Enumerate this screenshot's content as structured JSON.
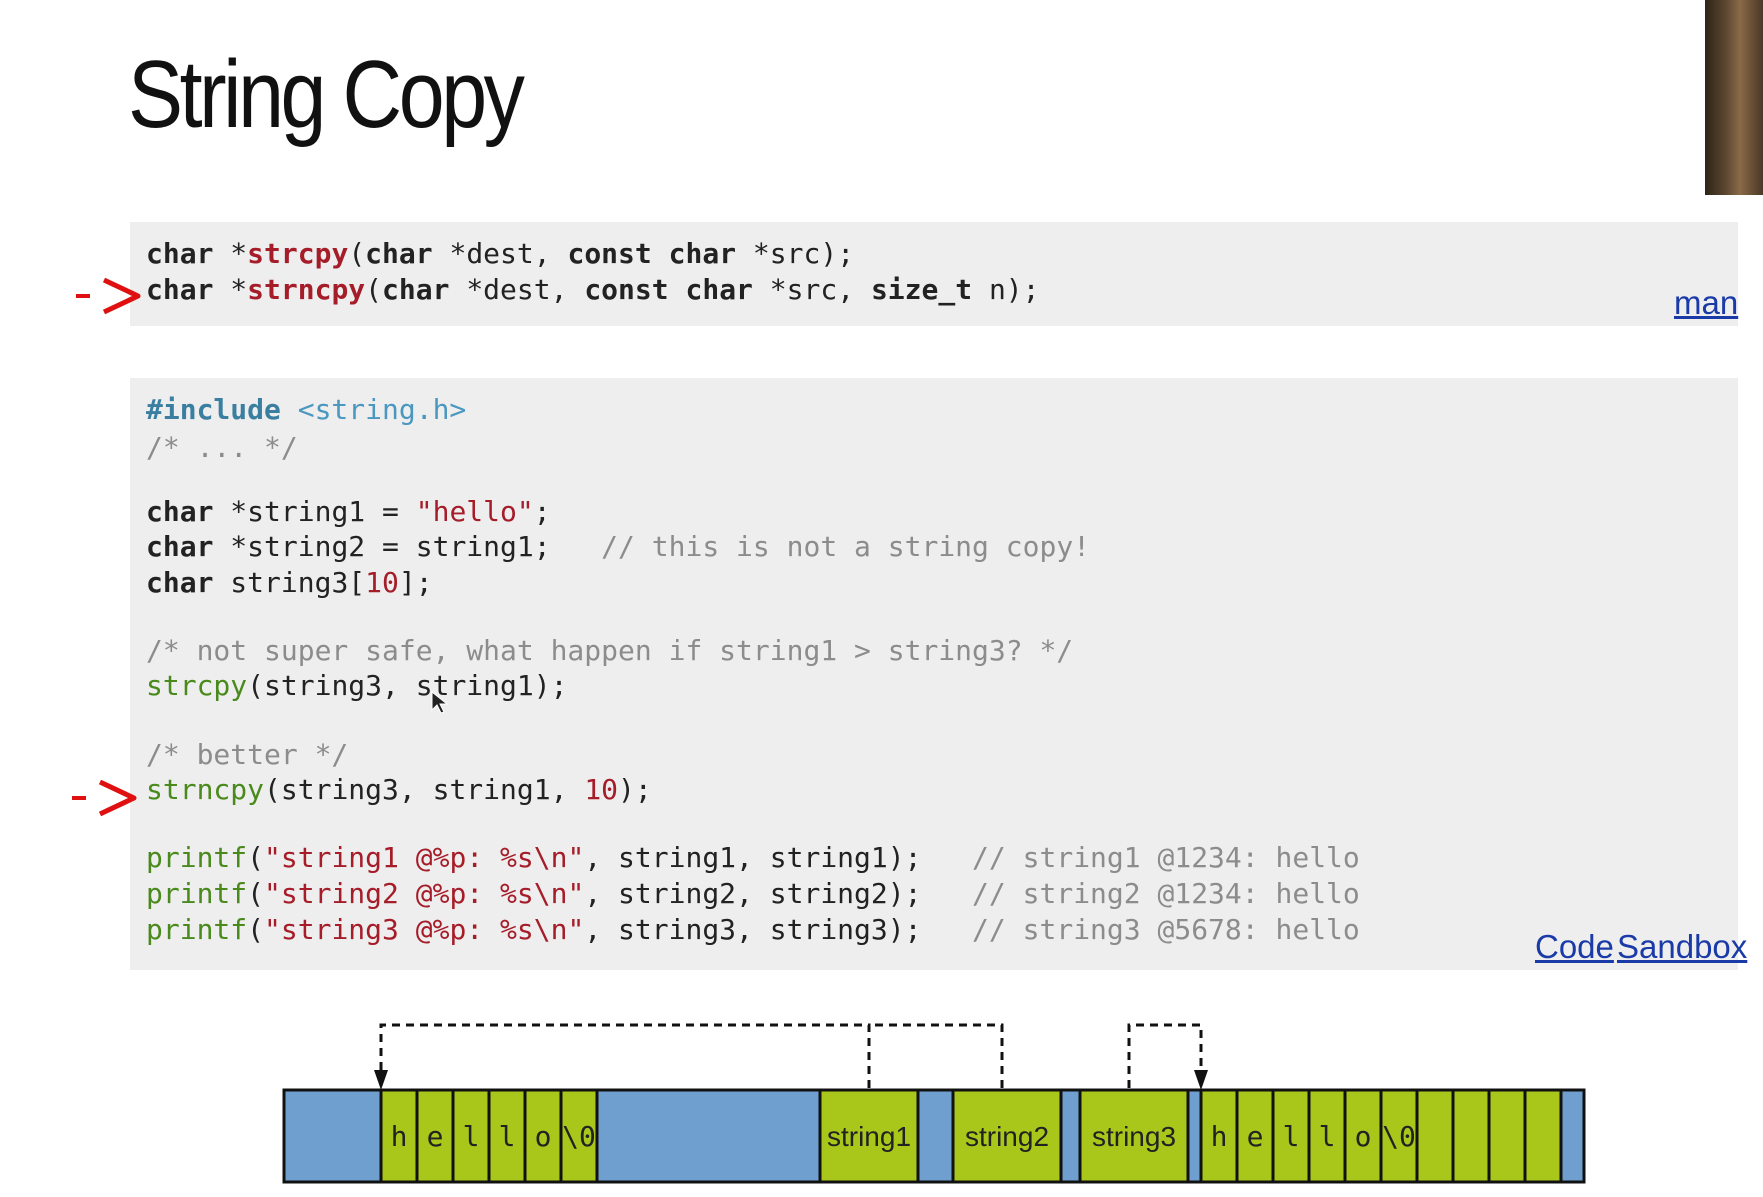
{
  "slide": {
    "title": "String Copy"
  },
  "signatures": {
    "line1": {
      "t1": "char",
      "t2": " *",
      "fn": "strcpy",
      "t3": "(",
      "t4": "char",
      "t5": " *dest, ",
      "t6": "const",
      "t7": " ",
      "t8": "char",
      "t9": " *src);"
    },
    "line2": {
      "t1": "char",
      "t2": " *",
      "fn": "strncpy",
      "t3": "(",
      "t4": "char",
      "t5": " *dest, ",
      "t6": "const",
      "t7": " ",
      "t8": "char",
      "t9": " *src, ",
      "t10": "size_t",
      "t11": " n);"
    },
    "man_link": "man"
  },
  "code": {
    "include_kw": "#include",
    "include_hdr": " <string.h>",
    "ellipsis_comment": "/* ... */",
    "decl1": {
      "kw": "char",
      "rest": " *string1 = ",
      "str": "\"hello\"",
      "end": ";"
    },
    "decl2": {
      "kw": "char",
      "rest": " *string2 = string1;   ",
      "cmt": "// this is not a string copy!"
    },
    "decl3": {
      "kw": "char",
      "rest": " string3[",
      "num": "10",
      "end": "];"
    },
    "comment_unsafe": "/* not super safe, what happen if string1 > string3? */",
    "strcpy_call": {
      "fn": "strcpy",
      "rest": "(string3, string1);"
    },
    "comment_better": "/* better */",
    "strncpy_call": {
      "fn": "strncpy",
      "rest": "(string3, string1, ",
      "num": "10",
      "end": ");"
    },
    "printf1": {
      "fn": "printf",
      "p1": "(",
      "str": "\"string1 @%p: %s\\n\"",
      "rest": ", string1, string1);   ",
      "cmt": "// string1 @1234: hello"
    },
    "printf2": {
      "fn": "printf",
      "p1": "(",
      "str": "\"string2 @%p: %s\\n\"",
      "rest": ", string2, string2);   ",
      "cmt": "// string2 @1234: hello"
    },
    "printf3": {
      "fn": "printf",
      "p1": "(",
      "str": "\"string3 @%p: %s\\n\"",
      "rest": ", string3, string3);   ",
      "cmt": "// string3 @5678: hello"
    },
    "link_code": "Code",
    "link_sandbox": "Sandbox"
  },
  "memory": {
    "hello_chars_1": [
      "h",
      "e",
      "l",
      "l",
      "o",
      "\\0"
    ],
    "pointers": [
      "string1",
      "string2",
      "string3"
    ],
    "hello_chars_2": [
      "h",
      "e",
      "l",
      "l",
      "o",
      "\\0"
    ],
    "empty_cells_after": 4
  },
  "colors": {
    "memory_blue": "#6f9fcf",
    "memory_green": "#a8c71a",
    "arrow_red": "#e01010",
    "link_blue": "#1a3aa8"
  },
  "icons": [
    "red-arrow-icon",
    "cursor-icon"
  ]
}
